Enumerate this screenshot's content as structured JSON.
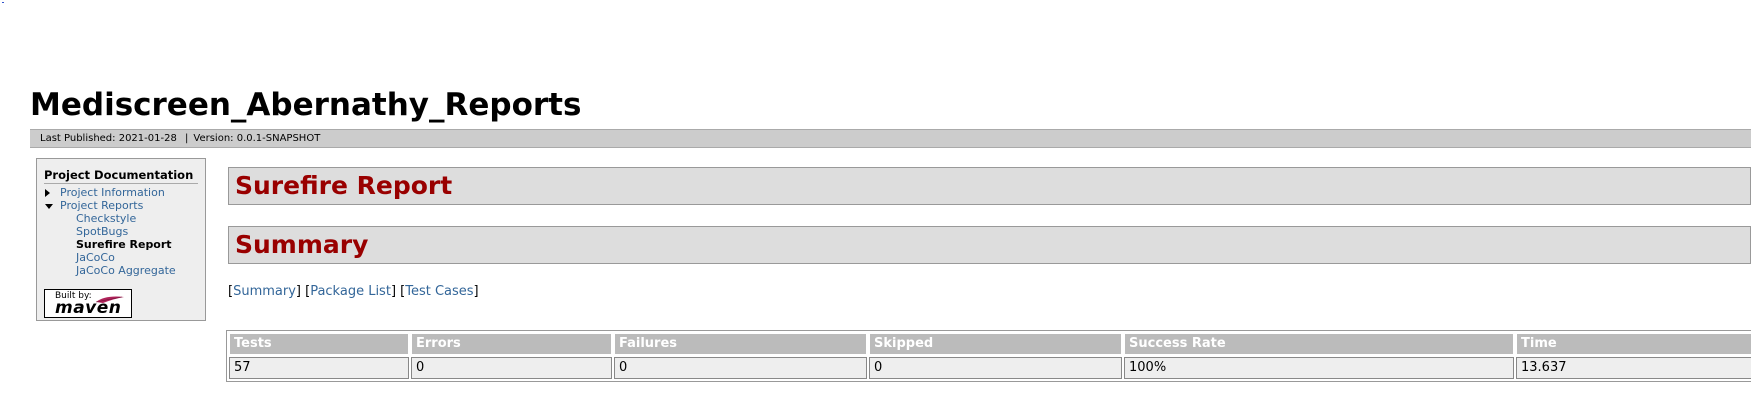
{
  "site": {
    "title": "Mediscreen_Abernathy_Reports"
  },
  "breadcrumbs": {
    "last_published": "Last Published: 2021-01-28",
    "separator": "|",
    "version": "Version: 0.0.1-SNAPSHOT"
  },
  "sidebar": {
    "heading": "Project Documentation",
    "items": [
      {
        "label": "Project Information",
        "icon": "arrow-right-icon"
      },
      {
        "label": "Project Reports",
        "icon": "arrow-down-icon"
      }
    ],
    "sub_items": [
      {
        "label": "Checkstyle"
      },
      {
        "label": "SpotBugs"
      },
      {
        "label": "Surefire Report",
        "active": true
      },
      {
        "label": "JaCoCo"
      },
      {
        "label": "JaCoCo Aggregate"
      }
    ],
    "built_by": {
      "small": "Built by:",
      "big": "maven"
    }
  },
  "main": {
    "section_title": "Surefire Report",
    "summary_title": "Summary",
    "links": {
      "summary": "Summary",
      "package_list": "Package List",
      "test_cases": "Test Cases"
    },
    "table": {
      "headers": [
        "Tests",
        "Errors",
        "Failures",
        "Skipped",
        "Success Rate",
        "Time"
      ],
      "row": [
        "57",
        "0",
        "0",
        "0",
        "100%",
        "13.637"
      ]
    }
  },
  "colors": {
    "heading_red": "#990000",
    "link_blue": "#336699",
    "bar_gray": "#dddddd",
    "table_header": "#bbbbbb"
  }
}
